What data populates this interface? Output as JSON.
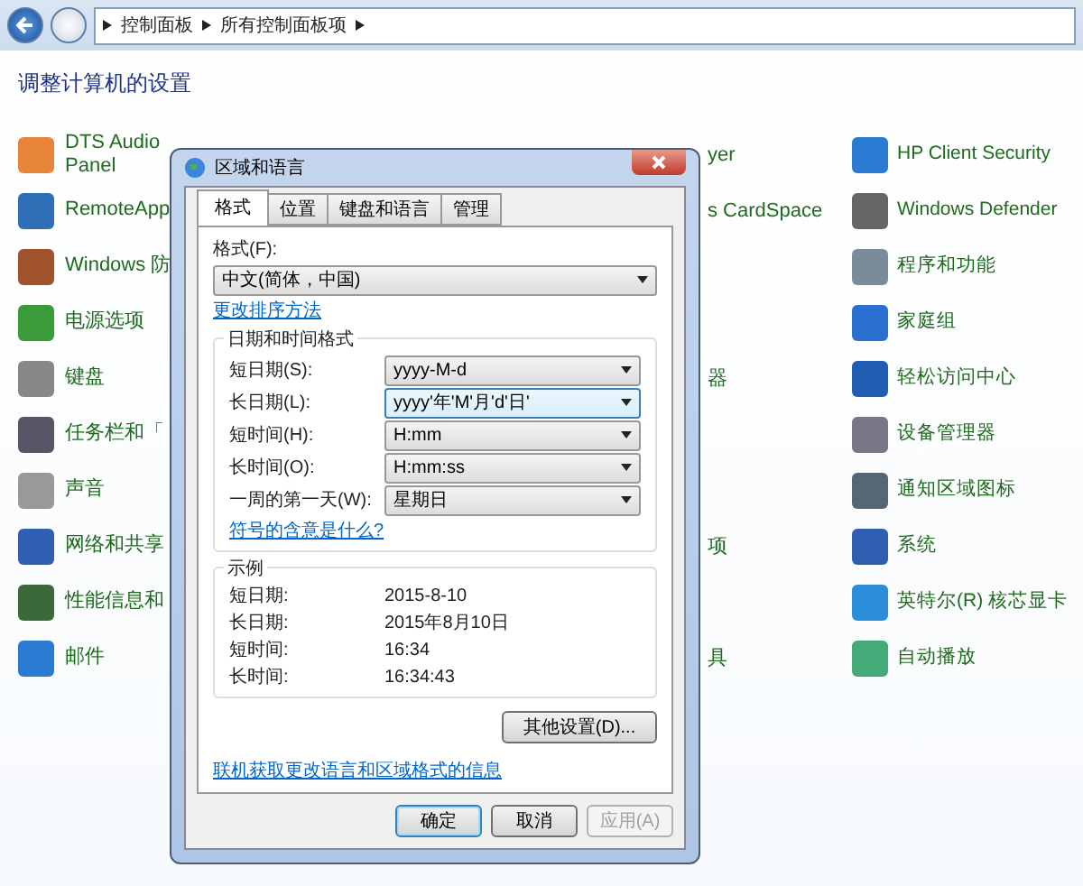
{
  "address_bar": {
    "path": [
      "控制面板",
      "所有控制面板项"
    ]
  },
  "heading": "调整计算机的设置",
  "rows": [
    {
      "left": {
        "lines": [
          "DTS Audio",
          "Panel"
        ]
      },
      "middle": "yer",
      "right": {
        "lines": [
          "HP Client Security"
        ]
      }
    },
    {
      "left": {
        "lines": [
          "RemoteApp"
        ]
      },
      "middle": "s CardSpace",
      "right": {
        "lines": [
          "Windows Defender"
        ]
      }
    },
    {
      "left": {
        "lines": [
          "Windows 防"
        ]
      },
      "right": {
        "lines": [
          "程序和功能"
        ]
      }
    },
    {
      "left": {
        "lines": [
          "电源选项"
        ]
      },
      "right": {
        "lines": [
          "家庭组"
        ]
      }
    },
    {
      "left": {
        "lines": [
          "键盘"
        ]
      },
      "middle": "器",
      "right": {
        "lines": [
          "轻松访问中心"
        ]
      }
    },
    {
      "left": {
        "lines": [
          "任务栏和「"
        ]
      },
      "right": {
        "lines": [
          "设备管理器"
        ]
      }
    },
    {
      "left": {
        "lines": [
          "声音"
        ]
      },
      "right": {
        "lines": [
          "通知区域图标"
        ]
      }
    },
    {
      "left": {
        "lines": [
          "网络和共享"
        ]
      },
      "middle": "项",
      "right": {
        "lines": [
          "系统"
        ]
      }
    },
    {
      "left": {
        "lines": [
          "性能信息和"
        ]
      },
      "right": {
        "lines": [
          "英特尔(R) 核芯显卡"
        ]
      }
    },
    {
      "left": {
        "lines": [
          "邮件"
        ]
      },
      "middle": "具",
      "right": {
        "lines": [
          "自动播放"
        ]
      }
    }
  ],
  "dialog": {
    "title": "区域和语言",
    "tabs": [
      {
        "label": "格式",
        "selected": true
      },
      {
        "label": "位置",
        "selected": false
      },
      {
        "label": "键盘和语言",
        "selected": false
      },
      {
        "label": "管理",
        "selected": false
      }
    ],
    "format_label": "格式(F):",
    "format_value": "中文(简体，中国)",
    "sort_link": "更改排序方法",
    "datetime_group": {
      "title": "日期和时间格式",
      "fields": [
        {
          "label": "短日期(S):",
          "value": "yyyy-M-d",
          "focused": false
        },
        {
          "label": "长日期(L):",
          "value": "yyyy'年'M'月'd'日'",
          "focused": true
        },
        {
          "label": "短时间(H):",
          "value": "H:mm",
          "focused": false
        },
        {
          "label": "长时间(O):",
          "value": "H:mm:ss",
          "focused": false
        },
        {
          "label": "一周的第一天(W):",
          "value": "星期日",
          "focused": false
        }
      ],
      "link": "符号的含意是什么?"
    },
    "example_group": {
      "title": "示例",
      "rows": [
        {
          "label": "短日期:",
          "value": "2015-8-10"
        },
        {
          "label": "长日期:",
          "value": "2015年8月10日"
        },
        {
          "label": "短时间:",
          "value": "16:34"
        },
        {
          "label": "长时间:",
          "value": "16:34:43"
        }
      ]
    },
    "other_settings_button": "其他设置(D)...",
    "online_link": "联机获取更改语言和区域格式的信息",
    "buttons": [
      {
        "label": "确定",
        "default": true,
        "disabled": false
      },
      {
        "label": "取消",
        "default": false,
        "disabled": false
      },
      {
        "label": "应用(A)",
        "default": false,
        "disabled": true
      }
    ]
  }
}
